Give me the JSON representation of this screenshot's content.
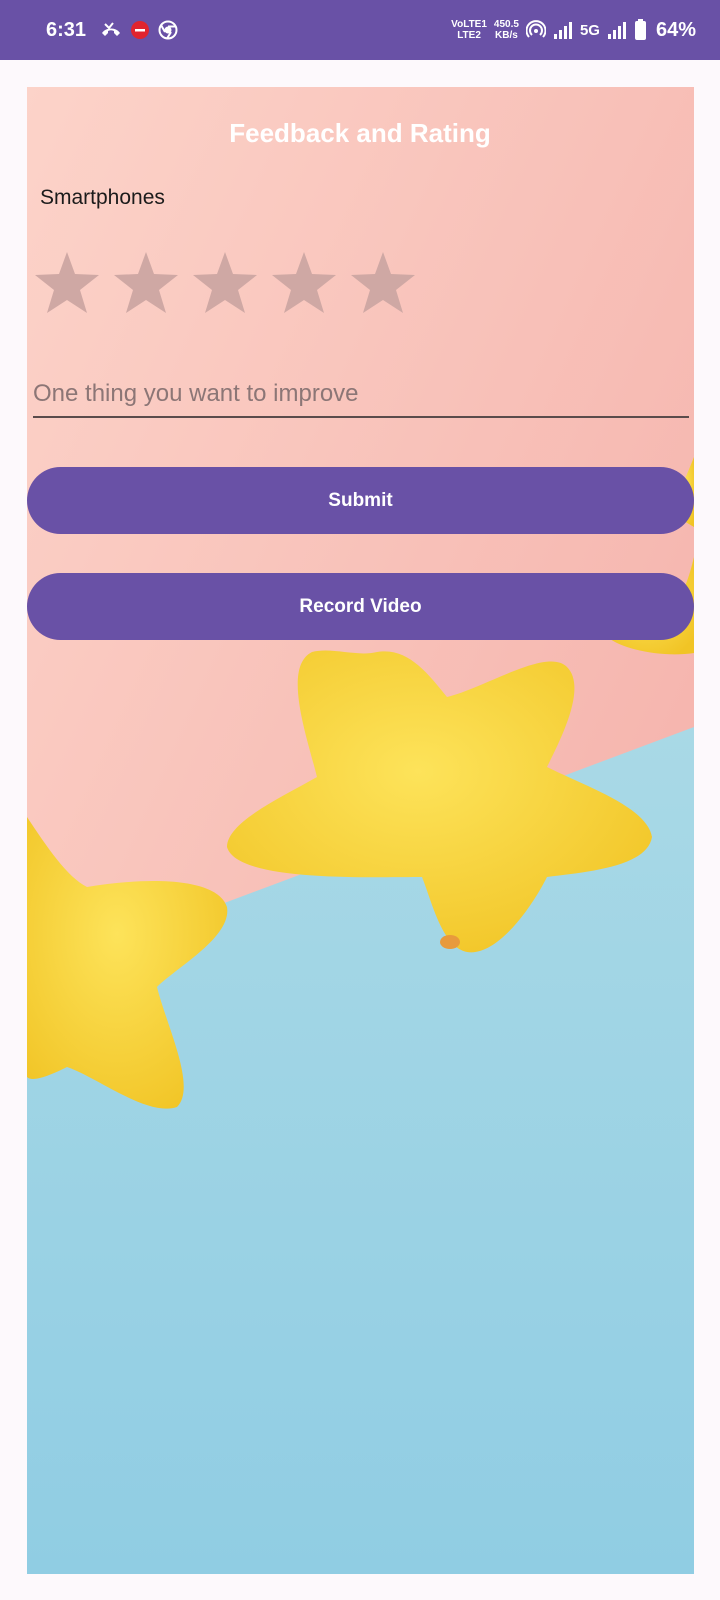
{
  "status_bar": {
    "time": "6:31",
    "network_top": "VoLTE1",
    "network_bottom": "LTE2",
    "speed_value": "450.5",
    "speed_unit": "KB/s",
    "network_type": "5G",
    "battery": "64%",
    "icons": [
      "missed-call-icon",
      "do-not-disturb-icon",
      "chrome-icon",
      "hotspot-icon",
      "signal-icon",
      "signal-icon-2",
      "battery-icon"
    ]
  },
  "screen": {
    "title": "Feedback and Rating",
    "category": "Smartphones",
    "rating": {
      "value": 0,
      "max": 5
    },
    "improve_input": {
      "placeholder": "One thing you want to improve",
      "value": ""
    },
    "submit_label": "Submit",
    "record_label": "Record Video"
  },
  "colors": {
    "primary": "#6951a6",
    "star_empty": "#cfa8a4",
    "background_pink": "#f6b9b1",
    "background_blue": "#9dd2e4",
    "decor_star_yellow": "#f6d53a"
  }
}
